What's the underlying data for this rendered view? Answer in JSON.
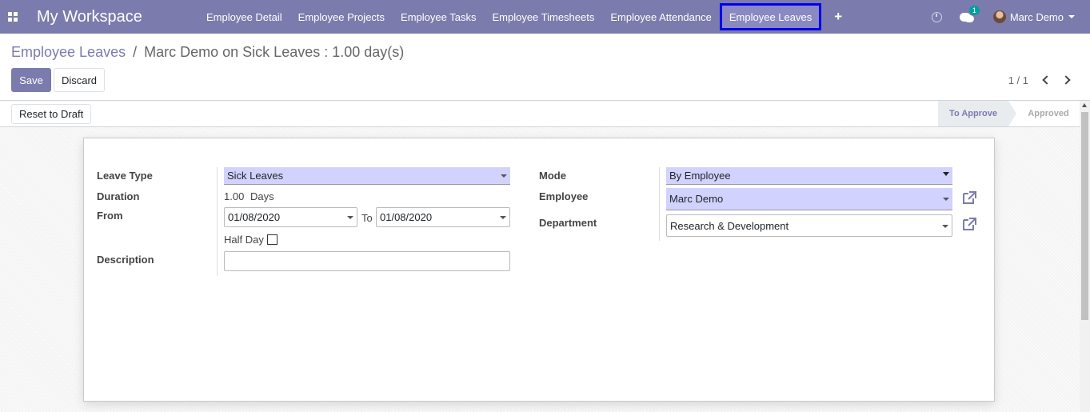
{
  "nav": {
    "brand": "My Workspace",
    "menu": [
      "Employee Detail",
      "Employee Projects",
      "Employee Tasks",
      "Employee Timesheets",
      "Employee Attendance",
      "Employee Leaves"
    ],
    "active_index": 5,
    "plus": "+",
    "chat_badge": "1",
    "user": "Marc Demo"
  },
  "breadcrumb": {
    "parent": "Employee Leaves",
    "separator": "/",
    "current": "Marc Demo on Sick Leaves : 1.00 day(s)"
  },
  "buttons": {
    "save": "Save",
    "discard": "Discard",
    "reset": "Reset to Draft"
  },
  "pager": {
    "value": "1 / 1"
  },
  "status": {
    "stages": [
      "To Approve",
      "Approved"
    ],
    "current": "To Approve"
  },
  "form": {
    "leave_type_label": "Leave Type",
    "leave_type": "Sick Leaves",
    "duration_label": "Duration",
    "duration_value": "1.00",
    "duration_unit": "Days",
    "from_label": "From",
    "date_from": "01/08/2020",
    "to_label": "To",
    "date_to": "01/08/2020",
    "half_day_label": "Half Day",
    "half_day_checked": false,
    "description_label": "Description",
    "description": "",
    "mode_label": "Mode",
    "mode": "By Employee",
    "employee_label": "Employee",
    "employee": "Marc Demo",
    "department_label": "Department",
    "department": "Research & Development"
  },
  "colors": {
    "nav_bg": "#7c7bad",
    "active_outline": "#0000ee",
    "required_field": "#d2d2ff",
    "badge": "#00a09d"
  }
}
